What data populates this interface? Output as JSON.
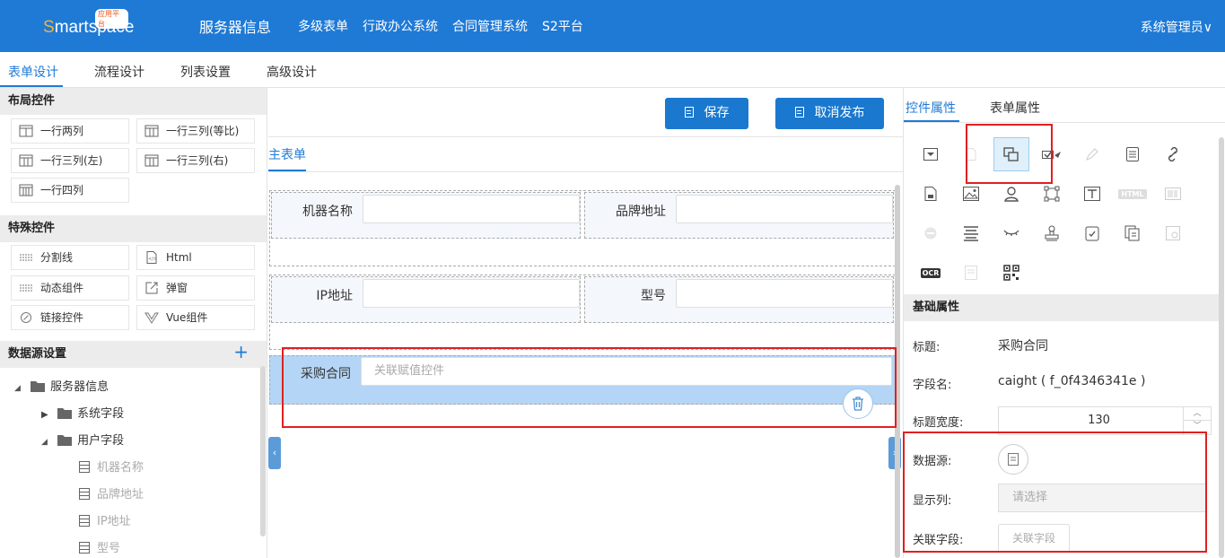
{
  "topbar": {
    "logo_text": "Smartspace",
    "logo_tag": "应用平台",
    "nav": [
      "服务器信息",
      "多级表单",
      "行政办公系统",
      "合同管理系统",
      "S2平台"
    ],
    "admin": "系统管理员∨"
  },
  "tabs": [
    "表单设计",
    "流程设计",
    "列表设置",
    "高级设计"
  ],
  "left": {
    "layout_header": "布局控件",
    "layout_controls": [
      "一行两列",
      "一行三列(等比)",
      "一行三列(左)",
      "一行三列(右)",
      "一行四列"
    ],
    "special_header": "特殊控件",
    "special_controls": [
      "分割线",
      "Html",
      "动态组件",
      "弹窗",
      "链接控件",
      "Vue组件"
    ],
    "datasource_header": "数据源设置",
    "plus": "+",
    "tree": {
      "root": "服务器信息",
      "system_fields": "系统字段",
      "user_fields": "用户字段",
      "leaves": [
        "机器名称",
        "品牌地址",
        "IP地址",
        "型号"
      ]
    }
  },
  "center": {
    "save_label": "保存",
    "unpublish_label": "取消发布",
    "main_tab": "主表单",
    "fields": {
      "machine_name": "机器名称",
      "brand_address": "品牌地址",
      "ip": "IP地址",
      "model": "型号",
      "purchase_contract": "采购合同",
      "purchase_placeholder": "关联赋值控件"
    },
    "left_arrow": "‹",
    "right_arrow": "›"
  },
  "right": {
    "tab_control": "控件属性",
    "tab_form": "表单属性",
    "basic_header": "基础属性",
    "props": {
      "title_label": "标题:",
      "title_value": "采购合同",
      "field_label": "字段名:",
      "field_value": "caight ( f_0f4346341e )",
      "width_label": "标题宽度:",
      "width_value": "130",
      "datasource_label": "数据源:",
      "display_label": "显示列:",
      "display_placeholder": "请选择",
      "relfield_label": "关联字段:",
      "relfield_button": "关联字段"
    },
    "ocr": "OCR",
    "html_tag": "HTML"
  },
  "colors": {
    "primary": "#1f7ad6",
    "highlight_red": "#e02020",
    "selected_row": "#b4d5f5"
  }
}
